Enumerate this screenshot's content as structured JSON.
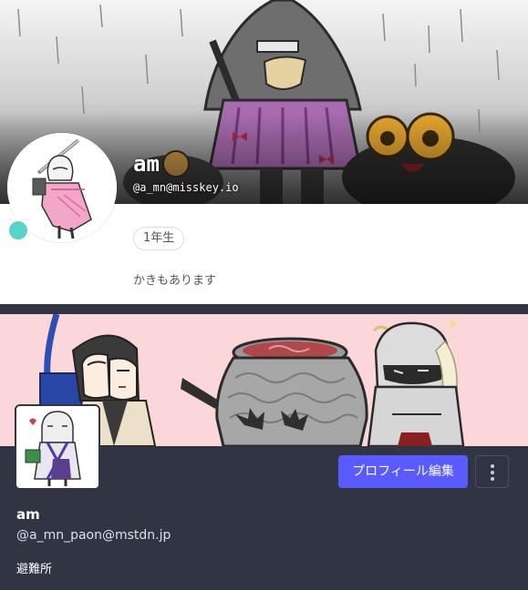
{
  "misskey": {
    "display_name": "am",
    "handle": "@a_mn@misskey.io",
    "badge": "1年生",
    "description": "かきもあります",
    "online_color": "#58d4c9",
    "avatar": "avatar-art",
    "banner": "banner-art"
  },
  "mastodon": {
    "edit_profile_label": "プロフィール編集",
    "more_icon": "vertical-ellipsis-icon",
    "display_name": "am",
    "handle": "@a_mn_paon@mstdn.jp",
    "note": "避難所",
    "accent_color": "#595aff",
    "avatar": "avatar-art",
    "banner": "banner-art"
  }
}
